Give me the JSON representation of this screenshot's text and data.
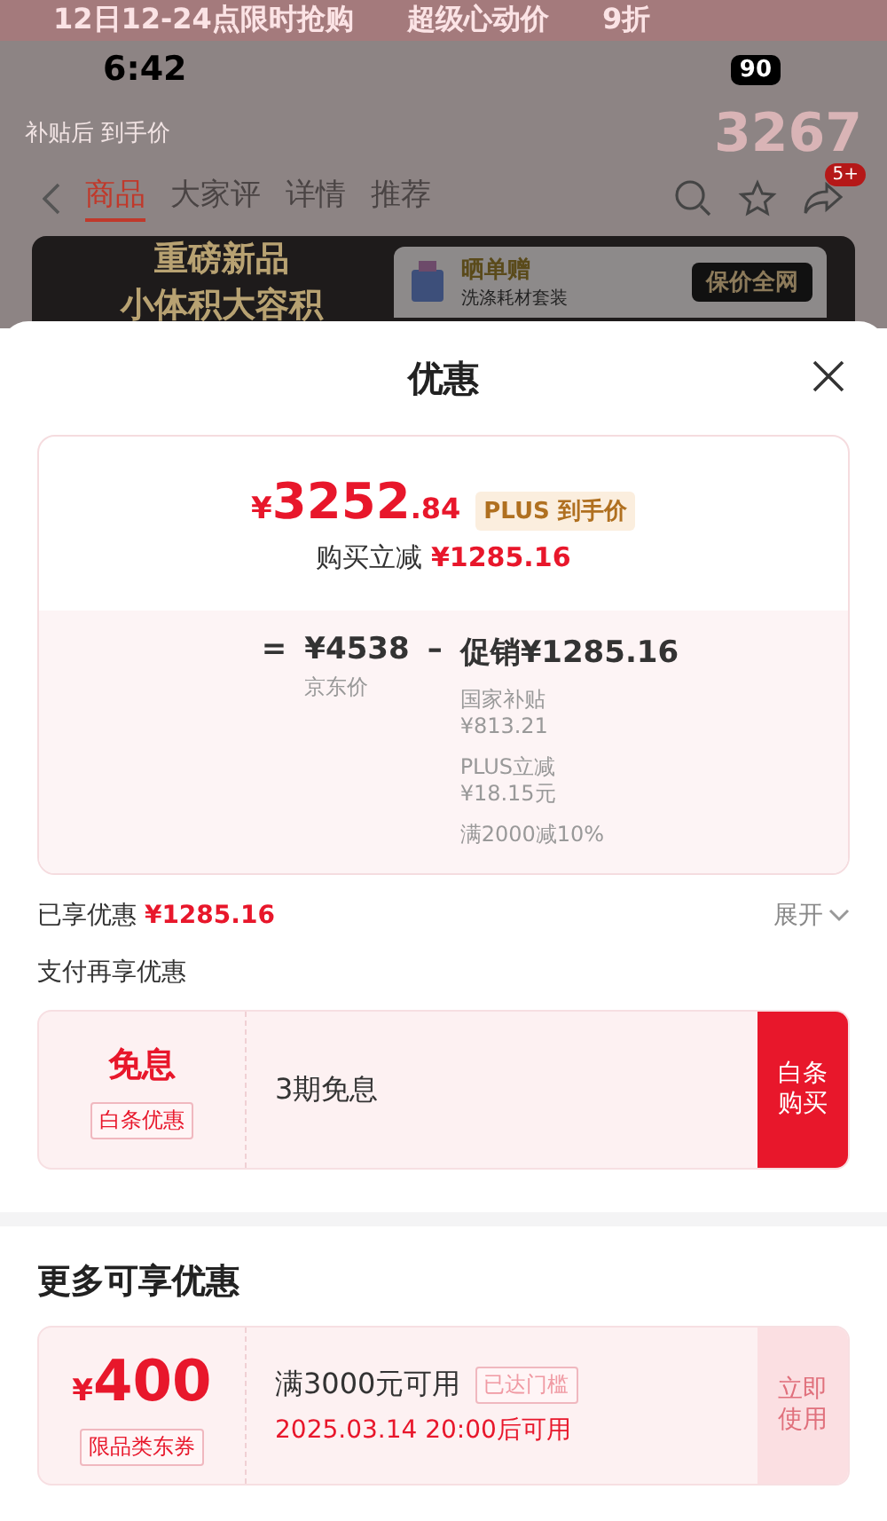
{
  "status_bar": {
    "time": "6:42",
    "battery": "90"
  },
  "background_page": {
    "banner_texts": [
      "12日12-24点限时抢购",
      "超级心动价",
      "9折"
    ],
    "subsidy": {
      "label_lines": [
        "补贴后",
        "到手价"
      ],
      "price": "3267"
    },
    "nav": {
      "tabs": [
        {
          "label": "商品",
          "selected": true
        },
        {
          "label": "大家评",
          "selected": false
        },
        {
          "label": "详情",
          "selected": false
        },
        {
          "label": "推荐",
          "selected": false
        }
      ],
      "badge": "5+"
    },
    "promo": {
      "title_lines": [
        "重磅新品",
        "小体积大容积"
      ],
      "gift_title": "晒单赠",
      "gift_subtitle": "洗涤耗材套装",
      "price_protect": "保价全网"
    }
  },
  "sheet": {
    "title": "优惠",
    "price_card": {
      "currency": "¥",
      "price_integer": "3252",
      "price_decimal": ".84",
      "price_tag": "PLUS 到手价",
      "discount_label": "购买立减",
      "discount_value": "¥1285.16",
      "formula": {
        "equals": "=",
        "base_price": "¥4538",
        "base_label": "京东价",
        "minus": "–",
        "promo_label": "促销",
        "promo_value": "¥1285.16",
        "items": [
          {
            "name": "国家补贴",
            "value": "¥813.21"
          },
          {
            "name": "PLUS立减",
            "value": "¥18.15元"
          },
          {
            "name": "满2000减10%"
          }
        ]
      }
    },
    "enjoyed": {
      "label": "已享优惠",
      "value": "¥1285.16",
      "toggle": "展开",
      "expanded": false
    },
    "payment": {
      "title": "支付再享优惠",
      "offer": {
        "headline": "免息",
        "tag": "白条优惠",
        "description": "3期免息",
        "button": "白条购买"
      }
    },
    "more": {
      "title": "更多可享优惠",
      "coupons": [
        {
          "currency": "¥",
          "amount": "400",
          "tag": "限品类东券",
          "condition": "满3000元可用",
          "status": "已达门槛",
          "time": "2025.03.14 20:00后可用",
          "button": "立即使用"
        }
      ]
    }
  }
}
